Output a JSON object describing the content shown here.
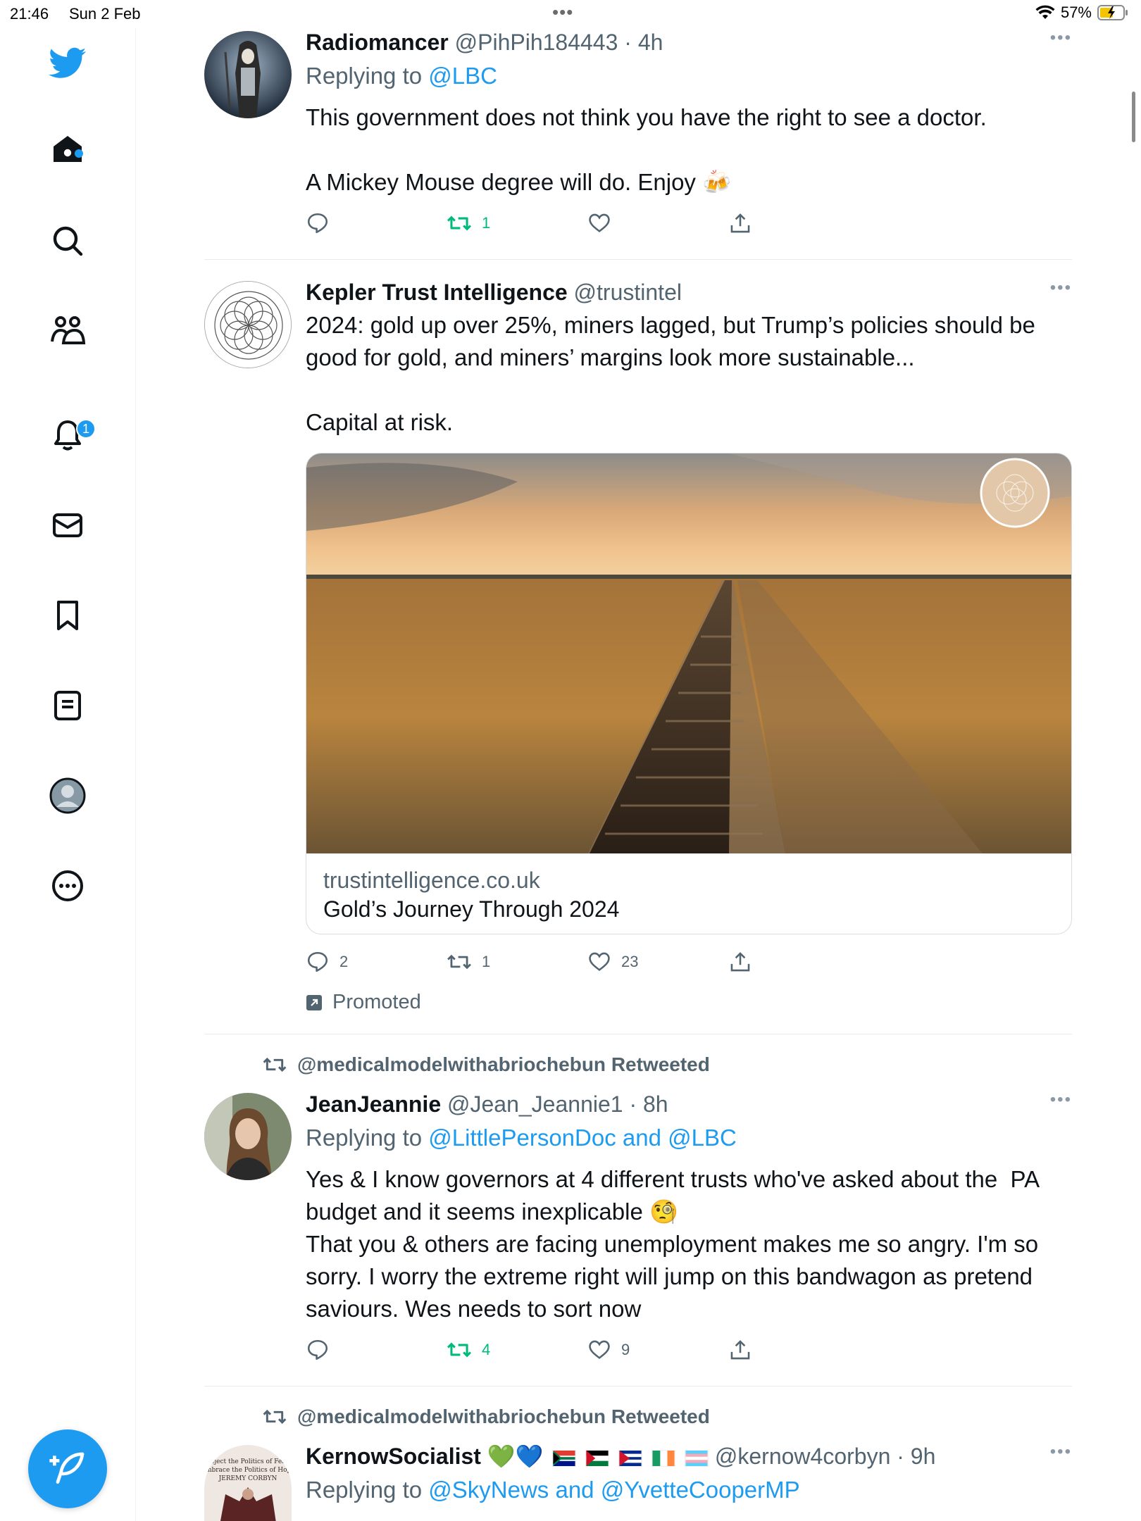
{
  "status_bar": {
    "time": "21:46",
    "date": "Sun 2 Feb",
    "battery": "57%",
    "dots": "•••"
  },
  "sidebar": {
    "items": [
      {
        "name": "twitter-logo",
        "icon": "twitter-bird-icon"
      },
      {
        "name": "home",
        "icon": "home-icon"
      },
      {
        "name": "explore",
        "icon": "search-icon"
      },
      {
        "name": "communities",
        "icon": "people-icon"
      },
      {
        "name": "notifications",
        "icon": "bell-icon"
      },
      {
        "name": "messages",
        "icon": "mail-icon"
      },
      {
        "name": "bookmarks",
        "icon": "bookmark-icon"
      },
      {
        "name": "lists",
        "icon": "list-icon"
      },
      {
        "name": "profile",
        "icon": "avatar-icon"
      },
      {
        "name": "more",
        "icon": "more-circle-icon"
      }
    ],
    "notification_count": "1",
    "compose_icon": "compose-feather-icon"
  },
  "colors": {
    "accent": "#1d9bf0",
    "retweeted": "#00ba7c",
    "text": "#0f1419",
    "secondary": "#536471"
  },
  "tweets": [
    {
      "name": "Radiomancer",
      "handle": "@PihPih184443 · 4h",
      "reply_prefix": "Replying to ",
      "reply_to": "@LBC",
      "text": "This government does not think you have the right to see a doctor.\n\nA Mickey Mouse degree will do. Enjoy 🍻",
      "replies": "",
      "retweets": "1",
      "likes": ""
    },
    {
      "name": "Kepler Trust Intelligence",
      "handle": "@trustintel",
      "text": "2024: gold up over 25%, miners lagged, but Trump’s policies should be good for gold, and miners’ margins look more sustainable...\n\nCapital at risk.",
      "card_domain": "trustintelligence.co.uk",
      "card_title": "Gold’s Journey Through 2024",
      "replies": "2",
      "retweets": "1",
      "likes": "23",
      "promoted": "Promoted"
    },
    {
      "retweeted_by": "@medicalmodelwithabriochebun Retweeted",
      "name": "JeanJeannie",
      "handle": "@Jean_Jeannie1 · 8h",
      "reply_prefix": "Replying to ",
      "reply_to": "@LittlePersonDoc and @LBC",
      "text": "Yes & I know governors at 4 different trusts who've asked about the  PA budget and it seems inexplicable 🧐\nThat you & others are facing unemployment makes me so angry. I'm so sorry. I worry the extreme right will jump on this bandwagon as pretend saviours. Wes needs to sort now",
      "replies": "",
      "retweets": "4",
      "likes": "9"
    },
    {
      "retweeted_by": "@medicalmodelwithabriochebun Retweeted",
      "name": "KernowSocialist 💚💙",
      "handle": "@kernow4corbyn · 9h",
      "reply_prefix": "Replying to ",
      "reply_to": "@SkyNews and @YvetteCooperMP",
      "avatar_text": "Reject the Politics of Fear, Embrace the Politics of Hope JEREMY CORBYN"
    }
  ]
}
